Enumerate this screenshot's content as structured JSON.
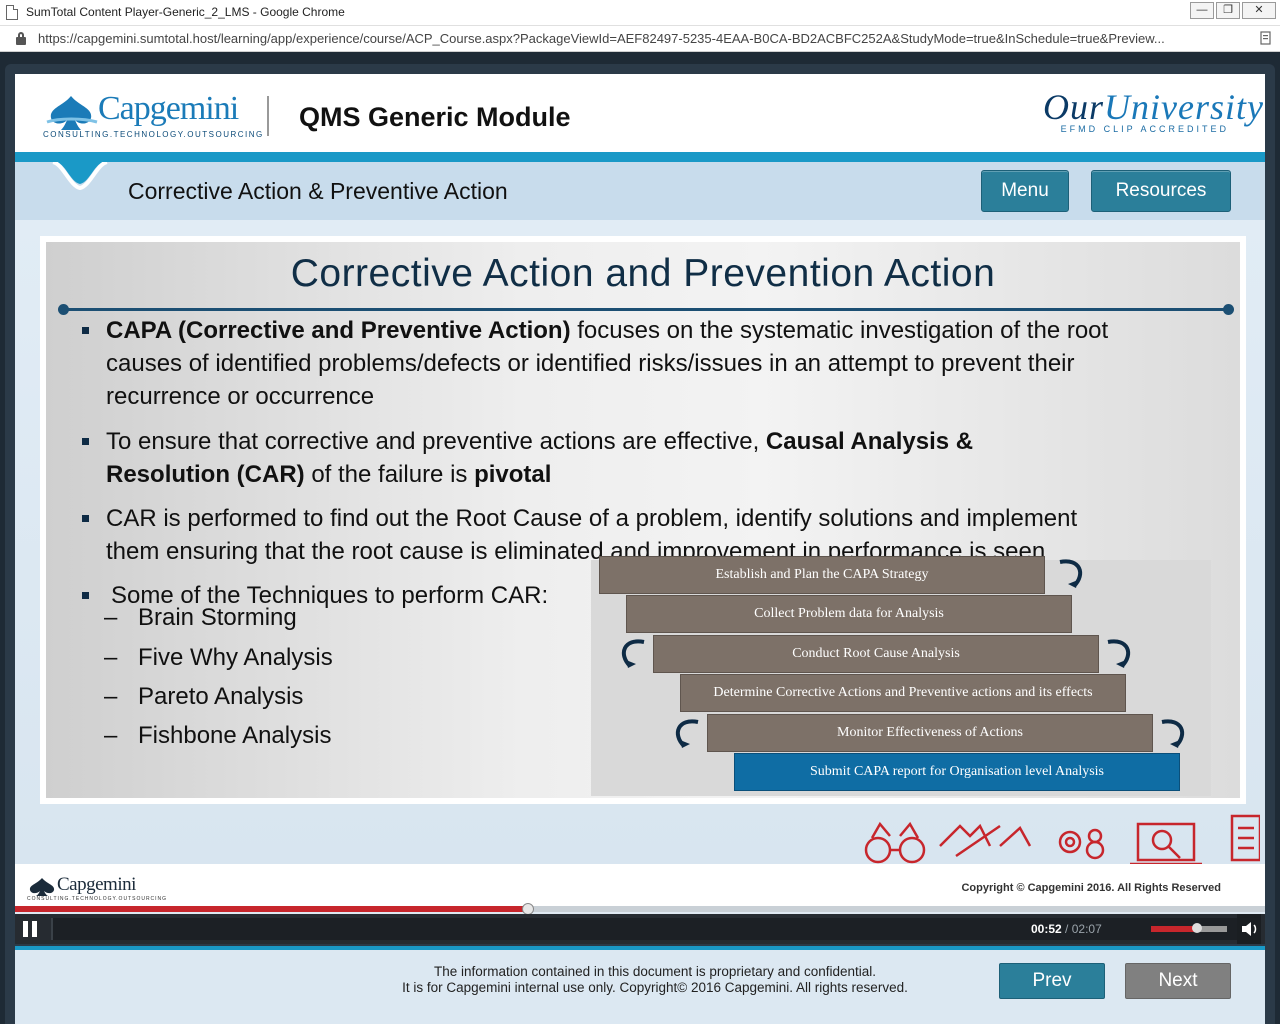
{
  "browser": {
    "window_title": "SumTotal Content Player-Generic_2_LMS - Google Chrome",
    "url": "https://capgemini.sumtotal.host/learning/app/experience/course/ACP_Course.aspx?PackageViewId=AEF82497-5235-4EAA-B0CA-BD2ACBFC252A&StudyMode=true&InSchedule=true&Preview...",
    "minimize_glyph": "—",
    "restore_glyph": "❐",
    "close_glyph": "✕"
  },
  "header": {
    "logo_wordmark": "Capgemini",
    "logo_tagline": "CONSULTING.TECHNOLOGY.OUTSOURCING",
    "module_title": "QMS Generic Module",
    "univ_logo_our": "Our",
    "univ_logo_university": "University",
    "univ_logo_tagline": "EFMD CLIP ACCREDITED"
  },
  "subheader": {
    "lesson_title": "Corrective Action & Preventive Action",
    "menu_button": "Menu",
    "resources_button": "Resources"
  },
  "slide": {
    "title": "Corrective Action and Prevention Action",
    "bullet1_bold": "CAPA (Corrective and Preventive Action)",
    "bullet1_rest": " focuses on the systematic investigation of the root",
    "bullet1_line2": "causes of identified problems/defects or identified risks/issues in an attempt to prevent their",
    "bullet1_line3": "recurrence or occurrence",
    "bullet2_text": "To ensure that corrective and preventive actions are effective, ",
    "bullet2_bold": "Causal Analysis &",
    "bullet2_bold2": "Resolution (CAR)",
    "bullet2_mid": " of the failure is ",
    "bullet2_bold3": "pivotal",
    "bullet3_line1": "CAR is performed to find out the Root Cause of a problem, identify solutions and implement",
    "bullet3_line2": "them ensuring that the root cause is eliminated and improvement in performance is seen",
    "bullet4": "Some of the Techniques to perform CAR:",
    "dash": "–",
    "techniques": [
      "Brain Storming",
      "Five Why Analysis",
      "Pareto Analysis",
      "Fishbone Analysis"
    ],
    "steps": [
      "Establish and Plan the CAPA Strategy",
      "Collect Problem data for Analysis",
      "Conduct Root Cause Analysis",
      "Determine Corrective Actions and Preventive actions and its effects",
      "Monitor Effectiveness of Actions",
      "Submit CAPA report for Organisation level Analysis"
    ]
  },
  "footer": {
    "small_logo": "Capgemini",
    "small_tagline": "CONSULTING.TECHNOLOGY.OUTSOURCING",
    "copyright": "Copyright © Capgemini 2016. All Rights Reserved"
  },
  "player": {
    "progress_fraction": 0.41,
    "volume_fraction": 0.6,
    "current_time": "00:52",
    "separator": " / ",
    "total_time": "02:07"
  },
  "bottom": {
    "disclaimer_line1": "The information contained in this document is proprietary and confidential.",
    "disclaimer_line2": "It is for Capgemini internal use only. Copyright© 2016 Capgemini. All rights reserved.",
    "prev_button": "Prev",
    "next_button": "Next"
  },
  "colors": {
    "accent_teal": "#2b7f9a",
    "brand_blue": "#1b7bb8",
    "progress_red": "#c7262c",
    "step_brown": "#7d7168",
    "step_final_blue": "#0f6da4"
  }
}
